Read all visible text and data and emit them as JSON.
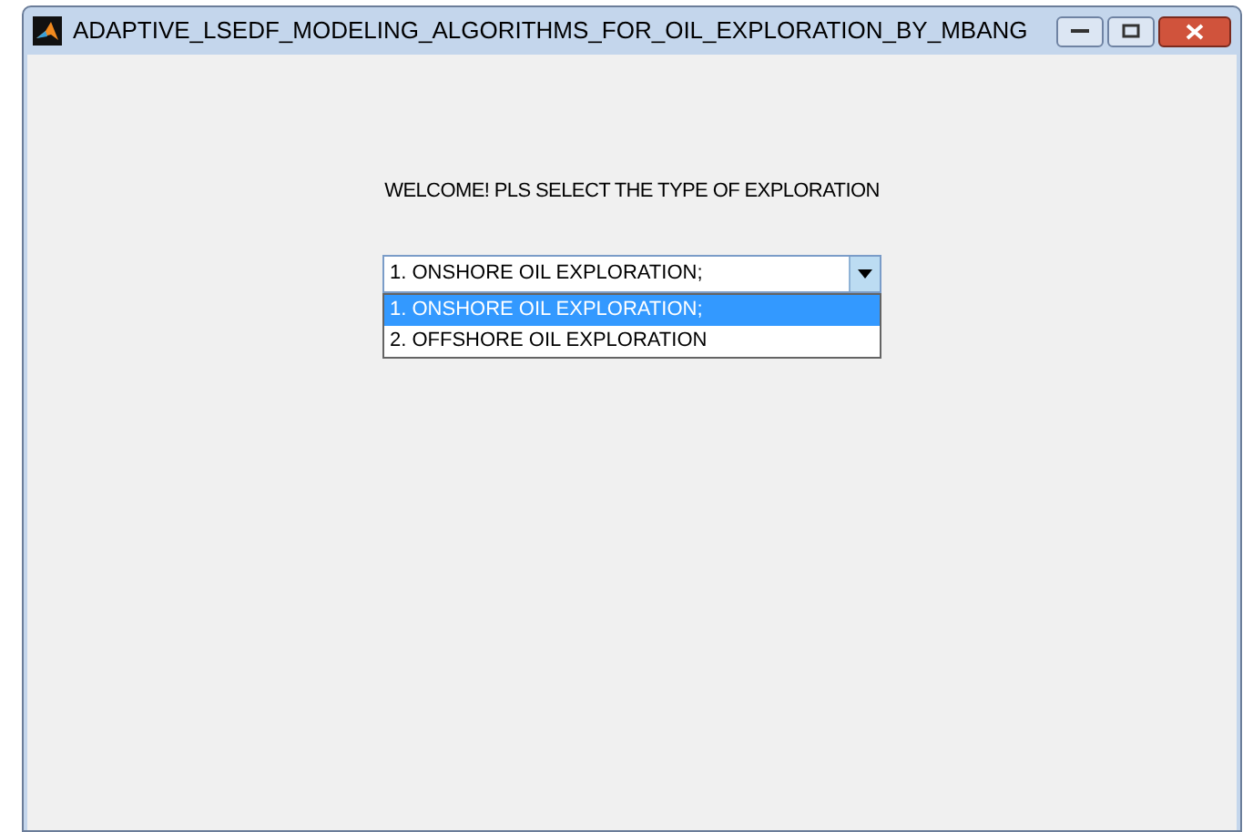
{
  "window": {
    "title": "ADAPTIVE_LSEDF_MODELING_ALGORITHMS_FOR_OIL_EXPLORATION_BY_MBANG"
  },
  "prompt": "WELCOME! PLS SELECT THE TYPE OF EXPLORATION",
  "dropdown": {
    "value": "1. ONSHORE OIL EXPLORATION;",
    "expanded": true,
    "options": [
      {
        "label": "1. ONSHORE OIL EXPLORATION;",
        "selected": true
      },
      {
        "label": "2. OFFSHORE OIL EXPLORATION",
        "selected": false
      }
    ]
  }
}
